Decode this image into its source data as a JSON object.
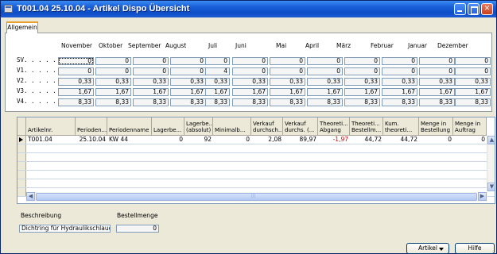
{
  "window": {
    "title": "T001.04 25.10.04 - Artikel Dispo Übersicht"
  },
  "tabs": [
    {
      "label": "Allgemein",
      "active": true
    }
  ],
  "months": [
    "November",
    "Oktober",
    "September",
    "August",
    "Juli",
    "Juni",
    "Mai",
    "April",
    "März",
    "Februar",
    "Januar",
    "Dezember"
  ],
  "rows": [
    {
      "label": "SV. . . . . .",
      "values": [
        "0",
        "0",
        "0",
        "0",
        "0",
        "0",
        "0",
        "0",
        "0",
        "0",
        "0",
        "0"
      ]
    },
    {
      "label": "V1. . . . . .",
      "values": [
        "0",
        "0",
        "0",
        "0",
        "4",
        "0",
        "0",
        "0",
        "0",
        "0",
        "0",
        "0"
      ]
    },
    {
      "label": "V2. . . . . .",
      "values": [
        "0,33",
        "0,33",
        "0,33",
        "0,33",
        "0,33",
        "0,33",
        "0,33",
        "0,33",
        "0,33",
        "0,33",
        "0,33",
        "0,33"
      ]
    },
    {
      "label": "V3. . . . . .",
      "values": [
        "1,67",
        "1,67",
        "1,67",
        "1,67",
        "1,67",
        "1,67",
        "1,67",
        "1,67",
        "1,67",
        "1,67",
        "1,67",
        "1,67"
      ]
    },
    {
      "label": "V4. . . . . .",
      "values": [
        "8,33",
        "8,33",
        "8,33",
        "8,33",
        "8,33",
        "8,33",
        "8,33",
        "8,33",
        "8,33",
        "8,33",
        "8,33",
        "8,33"
      ]
    }
  ],
  "grid": {
    "columns": [
      {
        "line1": "",
        "line2": "Artikelnr."
      },
      {
        "line1": "",
        "line2": "Perioden..."
      },
      {
        "line1": "",
        "line2": "Periodenname"
      },
      {
        "line1": "",
        "line2": "Lagerbe..."
      },
      {
        "line1": "Lagerbe...",
        "line2": "(absolut)"
      },
      {
        "line1": "",
        "line2": "Minimalb..."
      },
      {
        "line1": "Verkauf",
        "line2": "durchsch..."
      },
      {
        "line1": "Verkauf",
        "line2": "durchs. (..."
      },
      {
        "line1": "Theoreti...",
        "line2": "Abgang"
      },
      {
        "line1": "Theoreti...",
        "line2": "Bestellm..."
      },
      {
        "line1": "Kum.",
        "line2": "theoreti..."
      },
      {
        "line1": "Menge in",
        "line2": "Bestellung"
      },
      {
        "line1": "Menge in",
        "line2": "Auftrag"
      }
    ],
    "rows": [
      [
        "T001.04",
        "25.10.04",
        "KW 44",
        "0",
        "92",
        "0",
        "2,08",
        "89,97",
        "-1,97",
        "44,72",
        "44,72",
        "0",
        "0"
      ]
    ]
  },
  "footer": {
    "beschreibung_label": "Beschreibung",
    "beschreibung_value": "Dichtring für Hydraulikschlauch",
    "bestellmenge_label": "Bestellmenge",
    "bestellmenge_value": "0"
  },
  "buttons": {
    "artikel": "Artikel",
    "hilfe": "Hilfe"
  },
  "colors": {
    "title_bar": "#0d4ec8",
    "negative": "#d00000",
    "tab_accent": "#e8a02c"
  }
}
